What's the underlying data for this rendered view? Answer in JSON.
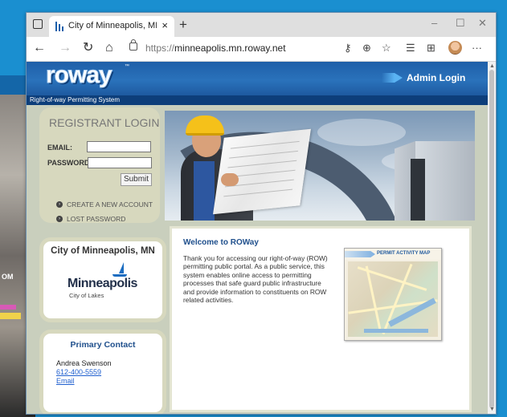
{
  "browser": {
    "tab_title": "City of Minneapolis, MN | ROWay",
    "tab_close": "×",
    "new_tab": "+",
    "address_proto": "https://",
    "address_host": "minneapolis.mn.roway.net",
    "more": "···"
  },
  "site": {
    "logo_text": "roway",
    "logo_tm": "™",
    "tagline": "Right-of-way Permitting System",
    "admin_login": "Admin Login"
  },
  "login": {
    "title": "REGISTRANT LOGIN",
    "email_label": "EMAIL:",
    "password_label": "PASSWORD:",
    "submit": "Submit",
    "create_account": "CREATE A NEW ACCOUNT",
    "lost_password": "LOST PASSWORD"
  },
  "city": {
    "title": "City of Minneapolis, MN",
    "logo_word": "Minneapolis",
    "logo_sub": "City of Lakes"
  },
  "contact": {
    "title": "Primary Contact",
    "name": "Andrea Swenson",
    "phone": "612-400-5559",
    "email": "Email"
  },
  "welcome": {
    "title": "Welcome to ROWay",
    "body": "Thank you for accessing our right-of-way (ROW) permitting public portal. As a public service, this system enables online access to permitting processes that safe guard public infrastructure and provide information to constituents on ROW related activities."
  },
  "map": {
    "label": "PERMIT ACTIVITY MAP"
  },
  "background": {
    "text": "OM"
  },
  "colors": {
    "accent": "#1a8fd0",
    "header_blue": "#1f5fa8",
    "panel_tan": "#d7d8be",
    "link_blue": "#1f5fcf"
  }
}
